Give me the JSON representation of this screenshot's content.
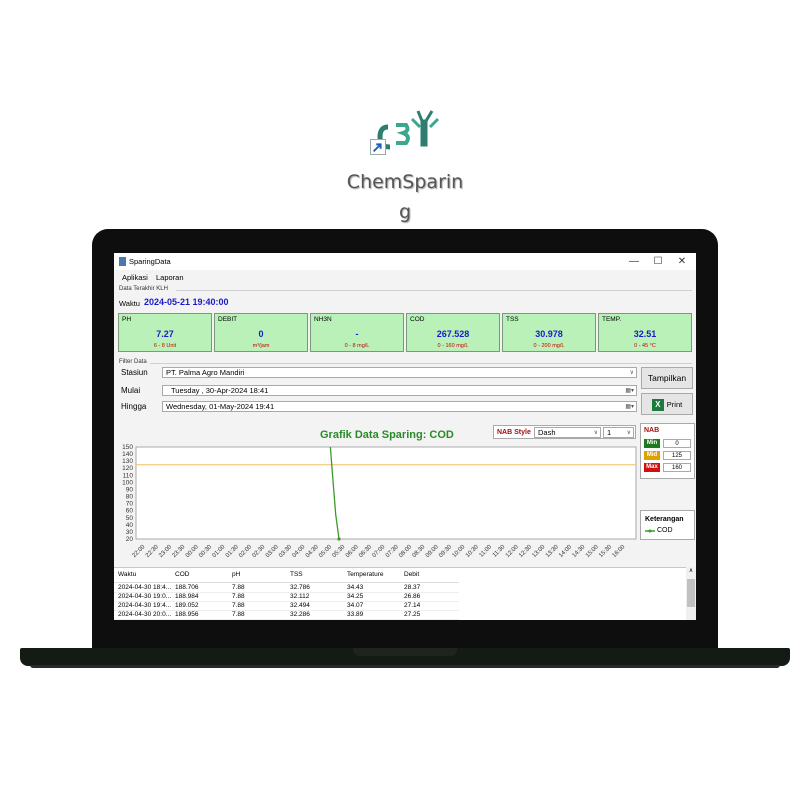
{
  "desktop": {
    "icon_label_1": "ChemSparin",
    "icon_label_2": "g"
  },
  "window": {
    "title": "SparingData",
    "minimize": "—",
    "maximize": "☐",
    "close": "✕"
  },
  "menu": [
    "Aplikasi",
    "Laporan"
  ],
  "last_data": {
    "section": "Data Terakhir KLH",
    "waktu_label": "Waktu",
    "waktu_value": "2024-05-21 19:40:00",
    "cards": [
      {
        "name": "PH",
        "value": "7.27",
        "range": "6 - 8 Unit"
      },
      {
        "name": "DEBIT",
        "value": "0",
        "range": "m³/jam"
      },
      {
        "name": "NH3N",
        "value": "-",
        "range": "0 - 8 mg/L"
      },
      {
        "name": "COD",
        "value": "267.528",
        "range": "0 - 160 mg/L"
      },
      {
        "name": "TSS",
        "value": "30.978",
        "range": "0 - 200 mg/L"
      },
      {
        "name": "TEMP.",
        "value": "32.51",
        "range": "0 - 45 °C"
      }
    ]
  },
  "filter": {
    "section": "Filter Data",
    "stasiun_label": "Stasiun",
    "stasiun_value": "PT. Palma Agro Mandiri",
    "mulai_label": "Mulai",
    "mulai_value": "Tuesday   , 30-Apr-2024 18:41",
    "hingga_label": "Hingga",
    "hingga_value": "Wednesday, 01-May-2024 19:41",
    "tampilkan": "Tampilkan",
    "print": "Print"
  },
  "chart_controls": {
    "nab_style_label": "NAB Style",
    "line_style": "Dash",
    "line_width": "1"
  },
  "chart_data": {
    "type": "line",
    "title": "Grafik Data Sparing: COD",
    "ylim": [
      20,
      150
    ],
    "y_ticks": [
      "150",
      "140",
      "130",
      "120",
      "110",
      "100",
      "90",
      "80",
      "70",
      "60",
      "50",
      "40",
      "30",
      "20"
    ],
    "x": [
      "22:00",
      "22:30",
      "23:00",
      "23:30",
      "00:00",
      "00:30",
      "01:00",
      "01:30",
      "02:00",
      "02:30",
      "03:00",
      "03:30",
      "04:00",
      "04:30",
      "05:00",
      "05:30",
      "06:00",
      "06:30",
      "07:00",
      "07:30",
      "08:00",
      "08:30",
      "09:00",
      "09:30",
      "10:00",
      "10:30",
      "11:00",
      "11:30",
      "12:00",
      "12:30",
      "13:00",
      "13:30",
      "14:00",
      "14:30",
      "15:00",
      "15:30",
      "16:00"
    ],
    "series": [
      {
        "name": "COD",
        "color": "#3a9a2a",
        "points": [
          [
            13.9,
            150
          ],
          [
            14.3,
            55
          ],
          [
            14.55,
            20
          ]
        ]
      }
    ],
    "reference_lines": [
      {
        "value": 125,
        "color": "#f0c060"
      }
    ],
    "grid": false
  },
  "nab": {
    "title": "NAB",
    "rows": [
      {
        "label": "Min",
        "value": "0",
        "color": "#1e7a1e"
      },
      {
        "label": "Mid",
        "value": "125",
        "color": "#e0a000"
      },
      {
        "label": "Max",
        "value": "160",
        "color": "#d01010"
      }
    ]
  },
  "legend": {
    "title": "Keterangan",
    "item": "COD"
  },
  "table": {
    "columns": [
      "Waktu",
      "COD",
      "pH",
      "TSS",
      "Temperature",
      "Debit"
    ],
    "rows": [
      [
        "2024-04-30 18:4...",
        "188.706",
        "7.88",
        "32.786",
        "34.43",
        "28.37"
      ],
      [
        "2024-04-30 19:0...",
        "188.984",
        "7.88",
        "32.112",
        "34.25",
        "26.86"
      ],
      [
        "2024-04-30 19:4...",
        "189.052",
        "7.88",
        "32.494",
        "34.07",
        "27.14"
      ],
      [
        "2024-04-30 20:0...",
        "188.956",
        "7.88",
        "32.286",
        "33.89",
        "27.25"
      ]
    ]
  }
}
